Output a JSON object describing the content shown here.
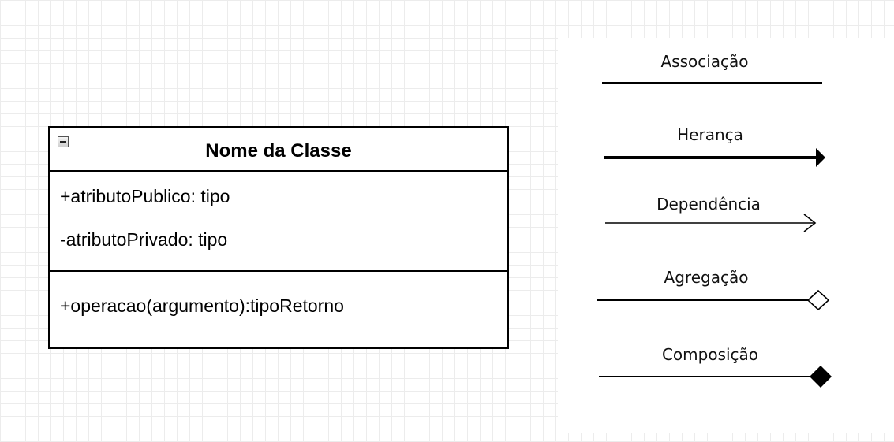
{
  "class_diagram": {
    "collapse_icon": "minus-box-icon",
    "class_name": "Nome da Classe",
    "attributes": [
      "+atributoPublico: tipo",
      "-atributoPrivado: tipo"
    ],
    "operations": [
      "+operacao(argumento):tipoRetorno"
    ]
  },
  "legend": {
    "items": [
      {
        "label": "Associação",
        "line_style": "solid thin",
        "end_marker": "none"
      },
      {
        "label": "Herança",
        "line_style": "solid thick",
        "end_marker": "filled-arrow"
      },
      {
        "label": "Dependência",
        "line_style": "solid thin",
        "end_marker": "open-arrow"
      },
      {
        "label": "Agregação",
        "line_style": "solid thin",
        "end_marker": "hollow-diamond"
      },
      {
        "label": "Composição",
        "line_style": "solid thin",
        "end_marker": "filled-diamond"
      }
    ]
  },
  "colors": {
    "line": "#000000",
    "grid": "#ececec",
    "background": "#ffffff"
  }
}
